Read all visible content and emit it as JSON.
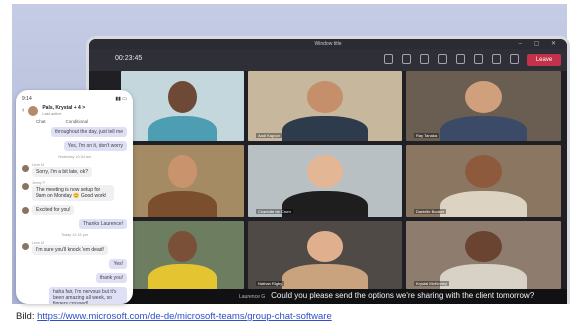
{
  "window": {
    "title": "Window title",
    "timer": "00:23:45",
    "leave_label": "Leave"
  },
  "participants": [
    {
      "name": "",
      "bg": "#c4d7dc",
      "skin": "#6e4a36",
      "shirt": "#4d9eb2"
    },
    {
      "name": "Aadi Kapoor",
      "bg": "#c7b79d",
      "skin": "#c58f6b",
      "shirt": "#2d3b4d"
    },
    {
      "name": "Ray Tanaka",
      "bg": "#6a5d52",
      "skin": "#d0a07c",
      "shirt": "#3b4a66"
    },
    {
      "name": "",
      "bg": "#a58b63",
      "skin": "#c9936e",
      "shirt": "#7b4f2e"
    },
    {
      "name": "Charlotte de Crum",
      "bg": "#b8c0c4",
      "skin": "#e3b795",
      "shirt": "#1e1e1e"
    },
    {
      "name": "Danielle Booker",
      "bg": "#8b7761",
      "skin": "#8d5a3e",
      "shirt": "#dcd3c2"
    },
    {
      "name": "",
      "bg": "#6d7d60",
      "skin": "#7b5038",
      "shirt": "#e5c432"
    },
    {
      "name": "Nathan Rigby",
      "bg": "#4f4a45",
      "skin": "#e0b08e",
      "shirt": "#c9a27e"
    },
    {
      "name": "Krystal McKinney",
      "bg": "#8e7d6e",
      "skin": "#6a4331",
      "shirt": "#d8d1c6"
    }
  ],
  "caption": {
    "speaker": "Laurence G",
    "text": "Could you please send the options we're sharing with the client tomorrow?"
  },
  "phone": {
    "time": "9:14",
    "title": "Pals, Krystal + 4 >",
    "subtitle": "Last active",
    "tab_chat": "Chat",
    "tab_conditional": "Conditional",
    "messages": [
      {
        "kind": "mine",
        "text": "throughout the day, just tell me"
      },
      {
        "kind": "mine",
        "text": "Yes, I'm on it, don't worry"
      },
      {
        "kind": "meta",
        "text": "Yesterday 10:34 am"
      },
      {
        "kind": "other",
        "sender": "Leon M",
        "text": "Sorry, I'm a bit late, ok?"
      },
      {
        "kind": "other",
        "sender": "Jenny P",
        "text": "The meeting is now setup for 9am on Monday 😊 Good work!"
      },
      {
        "kind": "other",
        "sender": "",
        "text": "Excited for you!"
      },
      {
        "kind": "mine",
        "text": "Thanks Laurence!"
      },
      {
        "kind": "meta",
        "text": "Today 12:16 pm"
      },
      {
        "kind": "other",
        "sender": "Leon M",
        "text": "I'm sure you'll knock 'em dead!"
      },
      {
        "kind": "mine",
        "text": "Yes!"
      },
      {
        "kind": "mine",
        "text": "thank you!"
      },
      {
        "kind": "mine",
        "text": "haha fair, I'm nervous but it's been amazing all week, so fingers crossed!"
      }
    ]
  },
  "credit": {
    "prefix": "Bild: ",
    "url": "https://www.microsoft.com/de-de/microsoft-teams/group-chat-software"
  }
}
